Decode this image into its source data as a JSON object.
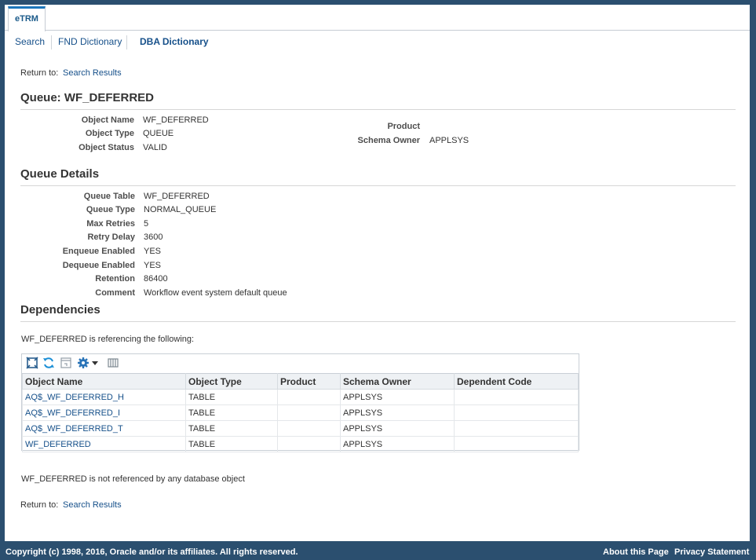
{
  "tabs": [
    {
      "label": "eTRM"
    }
  ],
  "subnav": {
    "search": "Search",
    "fnd": "FND Dictionary",
    "dba": "DBA Dictionary"
  },
  "return_to": {
    "label": "Return to:",
    "link": "Search Results"
  },
  "queue": {
    "title": "Queue: WF_DEFERRED",
    "object_name_label": "Object Name",
    "object_name": "WF_DEFERRED",
    "object_type_label": "Object Type",
    "object_type": "QUEUE",
    "object_status_label": "Object Status",
    "object_status": "VALID",
    "product_label": "Product",
    "product": "",
    "schema_owner_label": "Schema Owner",
    "schema_owner": "APPLSYS"
  },
  "details": {
    "title": "Queue Details",
    "rows": [
      {
        "label": "Queue Table",
        "value": "WF_DEFERRED"
      },
      {
        "label": "Queue Type",
        "value": "NORMAL_QUEUE"
      },
      {
        "label": "Max Retries",
        "value": "5"
      },
      {
        "label": "Retry Delay",
        "value": "3600"
      },
      {
        "label": "Enqueue Enabled",
        "value": "YES"
      },
      {
        "label": "Dequeue Enabled",
        "value": "YES"
      },
      {
        "label": "Retention",
        "value": "86400"
      },
      {
        "label": "Comment",
        "value": "Workflow event system default queue"
      }
    ]
  },
  "dependencies": {
    "title": "Dependencies",
    "referencing_text": "WF_DEFERRED is referencing the following:",
    "columns": [
      "Object Name",
      "Object Type",
      "Product",
      "Schema Owner",
      "Dependent Code"
    ],
    "rows": [
      [
        "AQ$_WF_DEFERRED_H",
        "TABLE",
        "",
        "APPLSYS",
        ""
      ],
      [
        "AQ$_WF_DEFERRED_I",
        "TABLE",
        "",
        "APPLSYS",
        ""
      ],
      [
        "AQ$_WF_DEFERRED_T",
        "TABLE",
        "",
        "APPLSYS",
        ""
      ],
      [
        "WF_DEFERRED",
        "TABLE",
        "",
        "APPLSYS",
        ""
      ]
    ],
    "not_referenced_text": "WF_DEFERRED is not referenced by any database object"
  },
  "footer": {
    "copyright": "Copyright (c) 1998, 2016, Oracle and/or its affiliates. All rights reserved.",
    "about": "About this Page",
    "privacy": "Privacy Statement"
  },
  "colors": {
    "frame": "#2b4f6f",
    "link": "#16508a",
    "tab_accent": "#1b75bb"
  }
}
